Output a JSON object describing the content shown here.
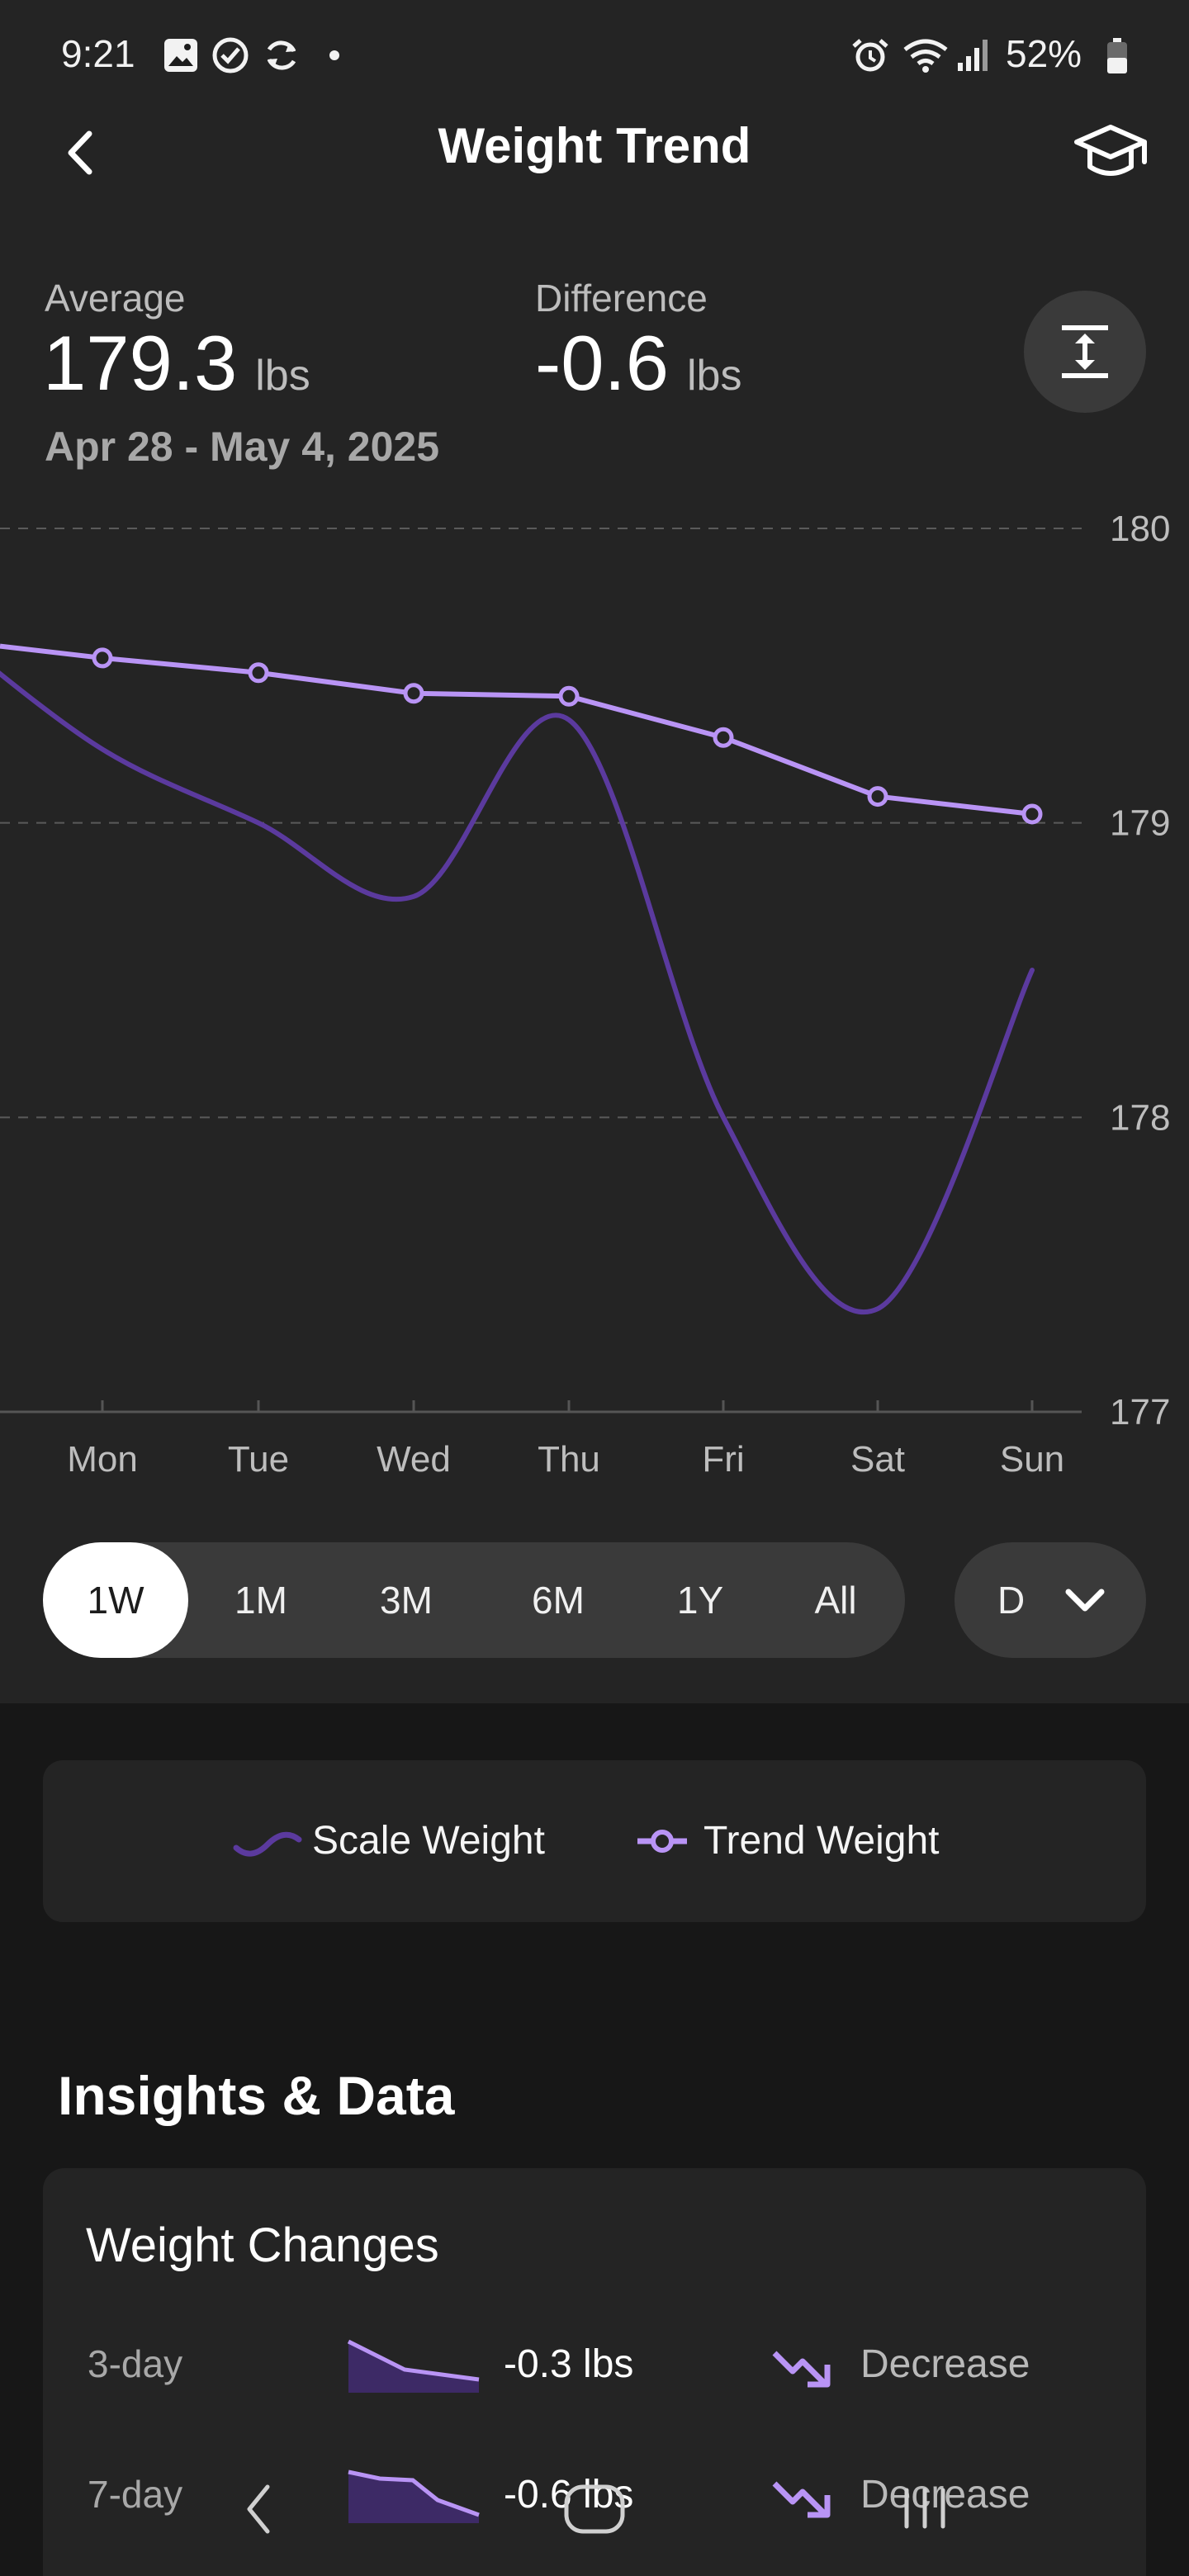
{
  "status_bar": {
    "time": "9:21",
    "battery": "52%"
  },
  "header": {
    "title": "Weight Trend",
    "back_icon": "chevron-left-icon",
    "learn_icon": "graduation-cap-icon"
  },
  "stats": {
    "average_label": "Average",
    "average_value": "179.3",
    "average_unit": "lbs",
    "difference_label": "Difference",
    "difference_value": "-0.6",
    "difference_unit": "lbs",
    "date_range": "Apr 28 - May 4, 2025"
  },
  "chart_data": {
    "type": "line",
    "categories": [
      "Mon",
      "Tue",
      "Wed",
      "Thu",
      "Fri",
      "Sat",
      "Sun"
    ],
    "y_ticks": [
      "180",
      "179",
      "178",
      "177"
    ],
    "ylim": [
      177,
      180
    ],
    "grid": true,
    "series": [
      {
        "name": "Scale Weight",
        "color": "#5b3a9e",
        "values": [
          179.25,
          179.0,
          178.75,
          179.35,
          178.0,
          177.35,
          178.5
        ]
      },
      {
        "name": "Trend Weight",
        "color": "#b994f5",
        "values": [
          179.56,
          179.51,
          179.44,
          179.43,
          179.29,
          179.09,
          179.03
        ]
      }
    ]
  },
  "range_selector": {
    "options": [
      "1W",
      "1M",
      "3M",
      "6M",
      "1Y",
      "All"
    ],
    "selected": "1W",
    "granularity": "D"
  },
  "legend": {
    "scale_label": "Scale Weight",
    "trend_label": "Trend Weight"
  },
  "insights": {
    "title": "Insights & Data",
    "card_title": "Weight Changes",
    "rows": [
      {
        "label": "3-day",
        "value": "-0.3 lbs",
        "status": "Decrease"
      },
      {
        "label": "7-day",
        "value": "-0.6 lbs",
        "status": "Decrease"
      }
    ]
  }
}
